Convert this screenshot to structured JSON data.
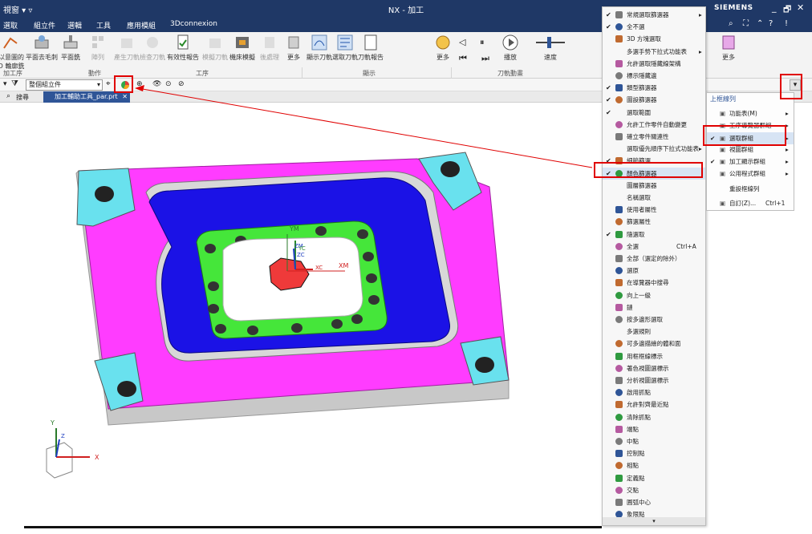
{
  "titlebar": {
    "left_text": "視窗 ▾ ▿",
    "app_title": "NX - 加工",
    "brand": "SIEMENS",
    "window_controls": [
      "_",
      "🗗",
      "✕"
    ]
  },
  "menubar": {
    "items": [
      "選取",
      "組立件",
      "選輯",
      "工具",
      "應用模組",
      "3Dconnexion"
    ]
  },
  "ribbon": {
    "buttons": [
      {
        "label": "以意圖的\nD 輪廓銑",
        "icon": "profile-mill-icon"
      },
      {
        "label": "平面去毛刺",
        "icon": "planar-deburr-icon"
      },
      {
        "label": "平面銑",
        "icon": "planar-mill-icon"
      },
      {
        "label": "陣列",
        "icon": "pattern-icon"
      },
      {
        "label": "產生刀軌",
        "icon": "generate-path-icon"
      },
      {
        "label": "檢查刀軌",
        "icon": "verify-path-icon"
      },
      {
        "label": "有效性報告",
        "icon": "validity-report-icon"
      },
      {
        "label": "模擬刀軌",
        "icon": "simulate-path-icon"
      },
      {
        "label": "機床模擬",
        "icon": "machine-sim-icon"
      },
      {
        "label": "後處理",
        "icon": "postprocess-icon"
      },
      {
        "label": "更多",
        "icon": "more-icon"
      },
      {
        "label": "顯示刀軌",
        "icon": "show-path-icon"
      },
      {
        "label": "選取刀軌",
        "icon": "select-path-icon"
      },
      {
        "label": "刀軌報告",
        "icon": "path-report-icon"
      },
      {
        "label": "更多",
        "icon": "more-icon"
      },
      {
        "label": "播放",
        "icon": "play-icon"
      },
      {
        "label": "速度",
        "icon": "speed-slider-icon"
      },
      {
        "label": "更多",
        "icon": "more-icon"
      }
    ],
    "groups": [
      "加工序",
      "動作",
      "工序",
      "顯示",
      "刀軌動畫"
    ]
  },
  "toolbar": {
    "filter_value": "整個組立件",
    "icons": [
      "color-filter-icon",
      "show-hide-icon",
      "dont-select-icon"
    ]
  },
  "tabs": {
    "search_label": "搜尋",
    "active_tab": "加工輔助工具_par.prt"
  },
  "context_menu": {
    "items": [
      {
        "checked": true,
        "label": "常規選取篩選器",
        "icon": "filter-icon",
        "submenu": true
      },
      {
        "checked": true,
        "label": "全不選",
        "icon": "deselect-icon"
      },
      {
        "checked": false,
        "label": "3D 方塊選取",
        "icon": "cube-select-icon"
      },
      {
        "checked": false,
        "label": "多選手勢下拉式功能表",
        "icon": "",
        "submenu": true
      },
      {
        "checked": false,
        "label": "允許選取隱藏線架構",
        "icon": "hidden-wire-icon"
      },
      {
        "checked": false,
        "label": "標示隱藏邊",
        "icon": "hidden-edge-icon"
      },
      {
        "checked": true,
        "label": "類型篩選器",
        "icon": "type-filter-icon"
      },
      {
        "checked": true,
        "label": "圖設篩選器",
        "icon": "layer-filter-icon"
      },
      {
        "checked": true,
        "label": "選取範圍",
        "icon": ""
      },
      {
        "checked": false,
        "label": "允許工作零件自動變更",
        "icon": "auto-change-icon"
      },
      {
        "checked": false,
        "label": "確立零件關連性",
        "icon": "establish-icon"
      },
      {
        "checked": false,
        "label": "選取優先順序下拉式功能表",
        "icon": "",
        "submenu": true
      },
      {
        "checked": true,
        "label": "細節篩選",
        "icon": "detail-filter-icon"
      },
      {
        "checked": true,
        "label": "顏色篩選器",
        "icon": "color-filter-icon"
      },
      {
        "checked": false,
        "label": "圖層篩選器",
        "icon": ""
      },
      {
        "checked": false,
        "label": "名稱選取",
        "icon": ""
      },
      {
        "checked": false,
        "label": "使用者屬性",
        "icon": "user-attr-icon"
      },
      {
        "checked": false,
        "label": "篩選屬性",
        "icon": "filter-attr-icon"
      },
      {
        "checked": true,
        "label": "隨選取",
        "icon": "select-icon"
      },
      {
        "checked": false,
        "label": "全選",
        "icon": "select-all-icon",
        "shortcut": "Ctrl+A"
      },
      {
        "checked": false,
        "label": "全部（選定的除外）",
        "icon": "all-except-icon"
      },
      {
        "checked": false,
        "label": "選原",
        "icon": "reselect-icon"
      },
      {
        "checked": false,
        "label": "在導覽器中搜尋",
        "icon": "nav-search-icon"
      },
      {
        "checked": false,
        "label": "向上一級",
        "icon": "up-level-icon"
      },
      {
        "checked": false,
        "label": "鏈",
        "icon": "chain-icon"
      },
      {
        "checked": false,
        "label": "按多邊形選取",
        "icon": "polygon-select-icon"
      },
      {
        "checked": false,
        "label": "多選規則",
        "icon": ""
      },
      {
        "checked": false,
        "label": "可多邊描繪的體和面",
        "icon": "bodies-faces-icon"
      },
      {
        "checked": false,
        "label": "用框框線標示",
        "icon": "frame-icon"
      },
      {
        "checked": false,
        "label": "著色視圖選標示",
        "icon": "shaded-view-icon"
      },
      {
        "checked": false,
        "label": "分析視圖選標示",
        "icon": "analysis-view-icon"
      },
      {
        "checked": false,
        "label": "啟用抓點",
        "icon": "snap-icon"
      },
      {
        "checked": false,
        "label": "允許對齊最近點",
        "icon": "snap-nearest-icon"
      },
      {
        "checked": false,
        "label": "清除抓點",
        "icon": "clear-snap-icon"
      },
      {
        "checked": false,
        "label": "端點",
        "icon": "endpoint-icon"
      },
      {
        "checked": false,
        "label": "中點",
        "icon": "midpoint-icon"
      },
      {
        "checked": false,
        "label": "控制點",
        "icon": "control-point-icon"
      },
      {
        "checked": false,
        "label": "相點",
        "icon": "intersect-point-icon"
      },
      {
        "checked": false,
        "label": "定義點",
        "icon": "define-point-icon"
      },
      {
        "checked": false,
        "label": "交點",
        "icon": "cross-point-icon"
      },
      {
        "checked": false,
        "label": "圓弧中心",
        "icon": "arc-center-icon"
      },
      {
        "checked": false,
        "label": "象限點",
        "icon": "quadrant-icon"
      }
    ],
    "scroll_indicator": "▾"
  },
  "right_panel": {
    "title": "上框線列",
    "items": [
      {
        "checked": false,
        "label": "功能表(M)",
        "icon": "menu-icon",
        "submenu": true
      },
      {
        "checked": false,
        "label": "工序導覽器群組",
        "icon": "navigator-icon",
        "submenu": true
      },
      {
        "checked": true,
        "label": "選取群組",
        "icon": "select-group-icon",
        "submenu": true
      },
      {
        "checked": false,
        "label": "視圖群組",
        "icon": "view-group-icon",
        "submenu": true
      },
      {
        "checked": true,
        "label": "加工顯示群組",
        "icon": "mfg-display-icon",
        "submenu": true
      },
      {
        "checked": false,
        "label": "公用程式群組",
        "icon": "utility-icon",
        "submenu": true
      },
      {
        "checked": false,
        "label": "重設框線列",
        "icon": ""
      },
      {
        "checked": false,
        "label": "自訂(Z)...",
        "icon": "customize-icon",
        "shortcut": "Ctrl+1"
      }
    ]
  },
  "canvas": {
    "labels": {
      "ym": "YM",
      "zm": "ZM",
      "xm": "XM",
      "yc": "YC",
      "zc": "ZC",
      "xc": "XC"
    },
    "triad": {
      "x": "X",
      "y": "Y",
      "z": "Z"
    }
  },
  "colors": {
    "magenta_plate": "#ff3cff",
    "blue_pocket": "#1b12e6",
    "green_ring": "#45e63a",
    "cyan_corners": "#69e1ee",
    "red_part": "#ef3a3a",
    "annotation_red": "#e00000",
    "title_bar": "#1f3866"
  }
}
